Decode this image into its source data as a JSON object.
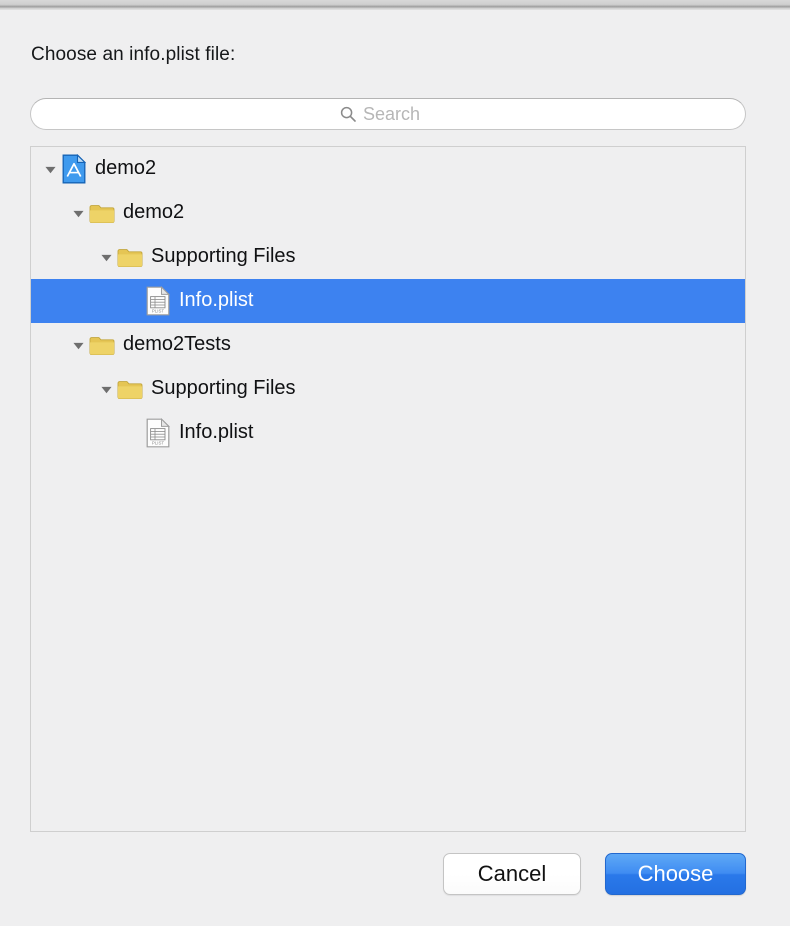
{
  "dialog": {
    "prompt": "Choose an info.plist file:"
  },
  "search": {
    "placeholder": "Search",
    "value": "",
    "icon": "search-icon"
  },
  "tree": {
    "rows": [
      {
        "label": "demo2",
        "icon": "xcode-project-icon",
        "depth": 0,
        "expanded": true,
        "has_disclosure": true,
        "selected": false
      },
      {
        "label": "demo2",
        "icon": "folder-icon",
        "depth": 1,
        "expanded": true,
        "has_disclosure": true,
        "selected": false
      },
      {
        "label": "Supporting Files",
        "icon": "folder-icon",
        "depth": 2,
        "expanded": true,
        "has_disclosure": true,
        "selected": false
      },
      {
        "label": "Info.plist",
        "icon": "plist-file-icon",
        "depth": 3,
        "expanded": false,
        "has_disclosure": false,
        "selected": true
      },
      {
        "label": "demo2Tests",
        "icon": "folder-icon",
        "depth": 1,
        "expanded": true,
        "has_disclosure": true,
        "selected": false
      },
      {
        "label": "Supporting Files",
        "icon": "folder-icon",
        "depth": 2,
        "expanded": true,
        "has_disclosure": true,
        "selected": false
      },
      {
        "label": "Info.plist",
        "icon": "plist-file-icon",
        "depth": 3,
        "expanded": false,
        "has_disclosure": false,
        "selected": false
      }
    ]
  },
  "buttons": {
    "cancel": "Cancel",
    "choose": "Choose"
  },
  "colors": {
    "selection_blue": "#3d82f0",
    "default_button_blue": "#2a79ea",
    "folder_yellow": "#e8c95a",
    "window_background": "#efeff0",
    "disclosure_gray": "#6e6e6e"
  }
}
